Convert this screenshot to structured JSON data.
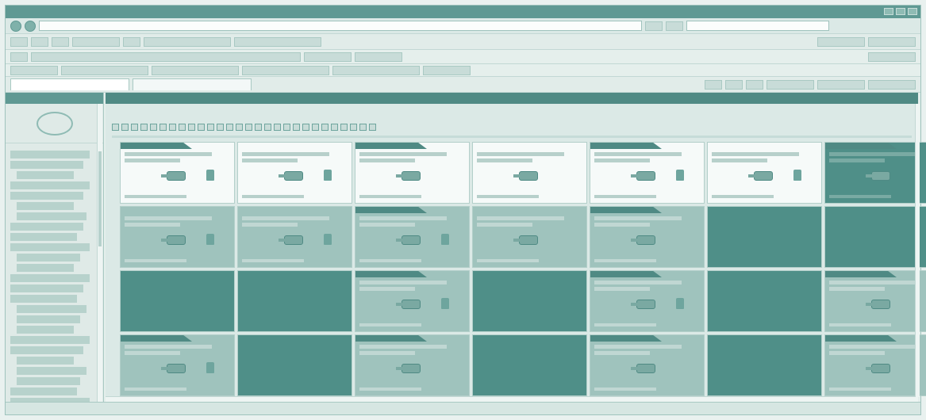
{
  "window": {
    "title": ""
  },
  "toolbar": {
    "back_label": "",
    "address": "",
    "search_placeholder": ""
  },
  "bookmarks": [],
  "tabs": [
    {
      "label": ""
    },
    {
      "label": ""
    }
  ],
  "sidebar": {
    "header": "",
    "items": []
  },
  "main": {
    "header": "",
    "right_info": ""
  },
  "colors": {
    "accent": "#5f9993",
    "dark_panel": "#4f8f88",
    "mid_panel": "#9fc3bd",
    "light_panel": "#f6faf9"
  }
}
